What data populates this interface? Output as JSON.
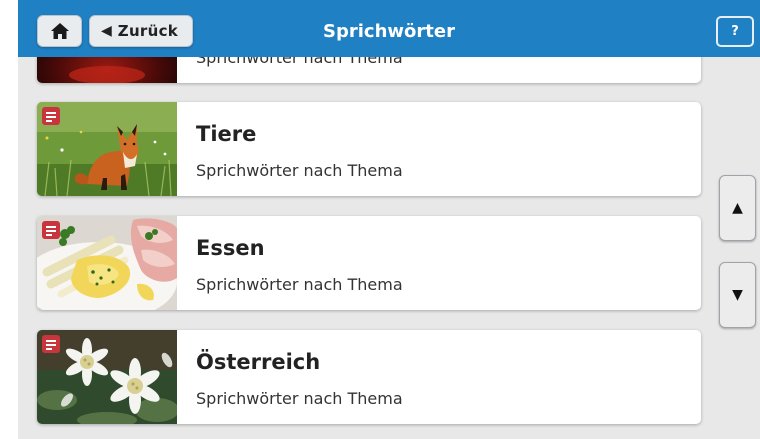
{
  "header": {
    "title": "Sprichwörter",
    "back_label": "Zurück",
    "home_icon": "home-icon",
    "help_label": "?",
    "color": "#1f80c4"
  },
  "cards": [
    {
      "title": "",
      "subtitle": "Sprichwörter nach Thema",
      "image": "red-dark-image",
      "icon": "document-icon"
    },
    {
      "title": "Tiere",
      "subtitle": "Sprichwörter nach Thema",
      "image": "fox-in-grass-image",
      "icon": "document-icon"
    },
    {
      "title": "Essen",
      "subtitle": "Sprichwörter nach Thema",
      "image": "asparagus-ham-plate-image",
      "icon": "document-icon"
    },
    {
      "title": "Österreich",
      "subtitle": "Sprichwörter nach Thema",
      "image": "edelweiss-flowers-image",
      "icon": "document-icon"
    }
  ],
  "scroll": {
    "up_icon": "triangle-up-icon",
    "down_icon": "triangle-down-icon"
  },
  "colors": {
    "badge": "#c9353d",
    "background": "#e8e8e8"
  }
}
